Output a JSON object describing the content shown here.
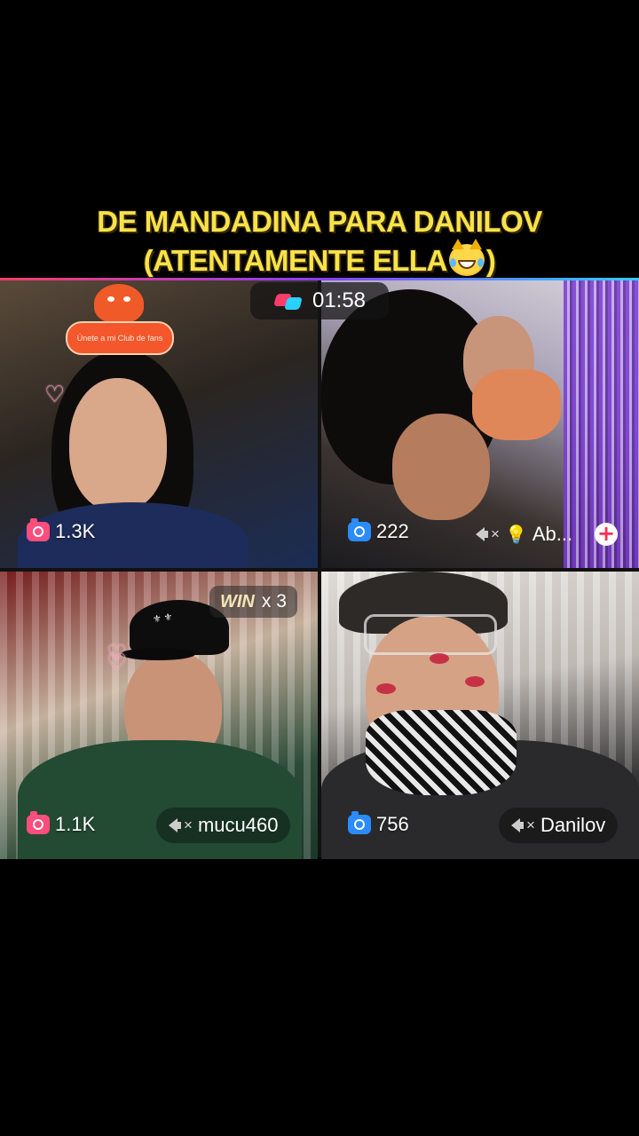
{
  "caption": {
    "line1": "DE MANDADINA PARA DANILOV",
    "line2_before_emoji": "(ATENTAMENTE ELLA",
    "line2_after_emoji": ")",
    "emoji": "cat-face-with-tears-of-joy-icon"
  },
  "battle": {
    "timer": "01:58",
    "timer_icon": "versus-icon"
  },
  "tiles": [
    {
      "id": "top-left",
      "likes": "1.3K",
      "likes_icon_color": "#ff4d7d",
      "club_banner": "Únete a mi Club de fans"
    },
    {
      "id": "top-right",
      "likes": "222",
      "likes_icon_color": "#2a8cff",
      "username": "Ab...",
      "username_prefix_icon": "lightbulb-icon",
      "muted": true
    },
    {
      "id": "bottom-left",
      "likes": "1.1K",
      "likes_icon_color": "#ff4d7d",
      "username": "mucu460",
      "muted": true,
      "win_label": "WIN",
      "win_count": "x 3"
    },
    {
      "id": "bottom-right",
      "likes": "756",
      "likes_icon_color": "#2a8cff",
      "username": "Danilov",
      "muted": true
    }
  ],
  "colors": {
    "caption_text": "#f7e34a",
    "accent_pink": "#ff3b6a",
    "accent_cyan": "#2ad0ff"
  }
}
